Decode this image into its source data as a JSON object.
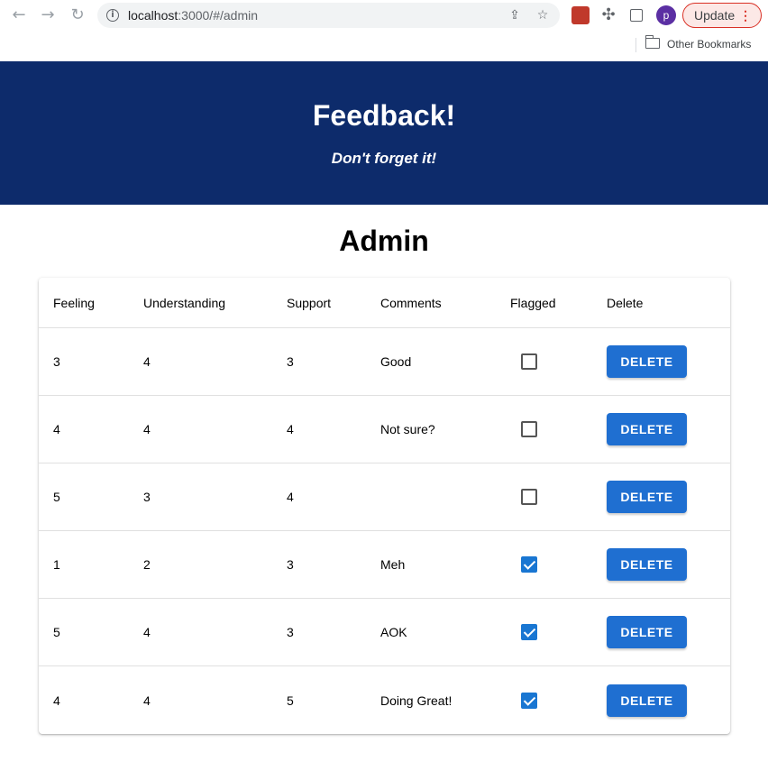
{
  "browser": {
    "url_host": "localhost",
    "url_path": ":3000/#/admin",
    "avatar_letter": "p",
    "update_label": "Update",
    "bookmark_label": "Other Bookmarks"
  },
  "header": {
    "title": "Feedback!",
    "subtitle": "Don't forget it!"
  },
  "page": {
    "title": "Admin"
  },
  "table": {
    "headers": [
      "Feeling",
      "Understanding",
      "Support",
      "Comments",
      "Flagged",
      "Delete"
    ],
    "rows": [
      {
        "feeling": "3",
        "understanding": "4",
        "support": "3",
        "comments": "Good",
        "flagged": false,
        "action": "DELETE"
      },
      {
        "feeling": "4",
        "understanding": "4",
        "support": "4",
        "comments": "Not sure?",
        "flagged": false,
        "action": "DELETE"
      },
      {
        "feeling": "5",
        "understanding": "3",
        "support": "4",
        "comments": "",
        "flagged": false,
        "action": "DELETE"
      },
      {
        "feeling": "1",
        "understanding": "2",
        "support": "3",
        "comments": "Meh",
        "flagged": true,
        "action": "DELETE"
      },
      {
        "feeling": "5",
        "understanding": "4",
        "support": "3",
        "comments": "AOK",
        "flagged": true,
        "action": "DELETE"
      },
      {
        "feeling": "4",
        "understanding": "4",
        "support": "5",
        "comments": "Doing Great!",
        "flagged": true,
        "action": "DELETE"
      }
    ]
  },
  "colors": {
    "header_bg": "#0d2b6b",
    "button_bg": "#1f6fd1",
    "checkbox_checked": "#1976d2"
  }
}
